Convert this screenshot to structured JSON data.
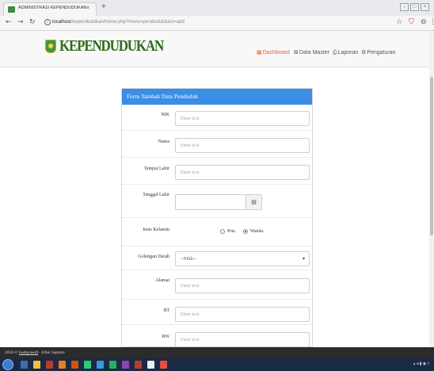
{
  "browser": {
    "tab_title": "ADMINISTRASI KEPENDUDUKAN",
    "tab_close": "×",
    "new_tab": "+",
    "url_host": "localhost",
    "url_path": "/kependudukan/home.php?menu=penduduk&act=add"
  },
  "app": {
    "brand": "KEPENDUDUKAN",
    "brand_color": "#2b6d1a",
    "accent_color": "#e8612c",
    "menu": [
      {
        "label": "Dashboard",
        "icon": "dashboard-icon",
        "active": true
      },
      {
        "label": "Data Master",
        "icon": "grid-icon",
        "active": false
      },
      {
        "label": "Laporan",
        "icon": "print-icon",
        "active": false
      },
      {
        "label": "Pengaturan",
        "icon": "gear-icon",
        "active": false
      }
    ]
  },
  "form": {
    "title": "Form Tambah Data Penduduk",
    "header_color": "#3a8ee6",
    "fields": {
      "nik": {
        "label": "NIK",
        "placeholder": "Enter text"
      },
      "nama": {
        "label": "Nama",
        "placeholder": "Enter text"
      },
      "tempat_lahir": {
        "label": "Tempat Lahir",
        "placeholder": "Enter text"
      },
      "tanggal_lahir": {
        "label": "Tanggal Lahir",
        "placeholder": ""
      },
      "jenis_kelamin": {
        "label": "Jenis Kelamin",
        "options": [
          "Pria",
          "Wanita"
        ],
        "selected": "Wanita"
      },
      "golongan_darah": {
        "label": "Golongan Darah",
        "value": "--Pilih--"
      },
      "alamat": {
        "label": "Alamat",
        "placeholder": "Enter text"
      },
      "rt": {
        "label": "RT",
        "placeholder": "Enter text"
      },
      "rw": {
        "label": "RW",
        "placeholder": "Enter text"
      }
    }
  },
  "footer": {
    "prefix": "2016 ©",
    "link": "budayasoft",
    "suffix": "- Irfan Saputra"
  }
}
